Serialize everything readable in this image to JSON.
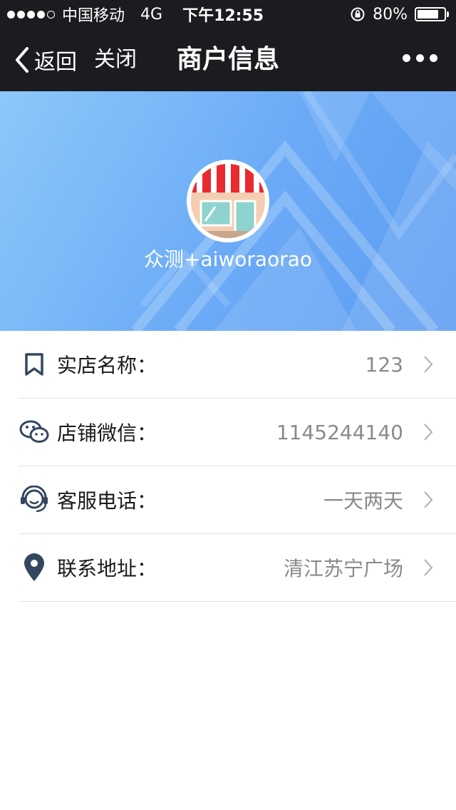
{
  "status_bar": {
    "carrier": "中国移动",
    "network": "4G",
    "time": "下午12:55",
    "battery": "80%",
    "battery_level": 0.8
  },
  "nav": {
    "back_label": "返回",
    "close_label": "关闭",
    "title": "商户信息",
    "more_icon": "more-dots-icon"
  },
  "banner": {
    "shop_name": "众测+aiworaorao",
    "avatar_icon": "storefront-icon"
  },
  "rows": [
    {
      "icon": "bookmark-icon",
      "label": "实店名称：",
      "value": "123"
    },
    {
      "icon": "wechat-icon",
      "label": "店铺微信：",
      "value": "1145244140"
    },
    {
      "icon": "headset-icon",
      "label": "客服电话：",
      "value": "一天两天"
    },
    {
      "icon": "location-pin-icon",
      "label": "联系地址：",
      "value": "清江苏宁广场"
    }
  ],
  "colors": {
    "bar_bg": "#1c1c20",
    "banner_start": "#8cc8fa",
    "banner_end": "#5c9cf2",
    "icon_color": "#33475e",
    "value_color": "#8a8a8a"
  }
}
